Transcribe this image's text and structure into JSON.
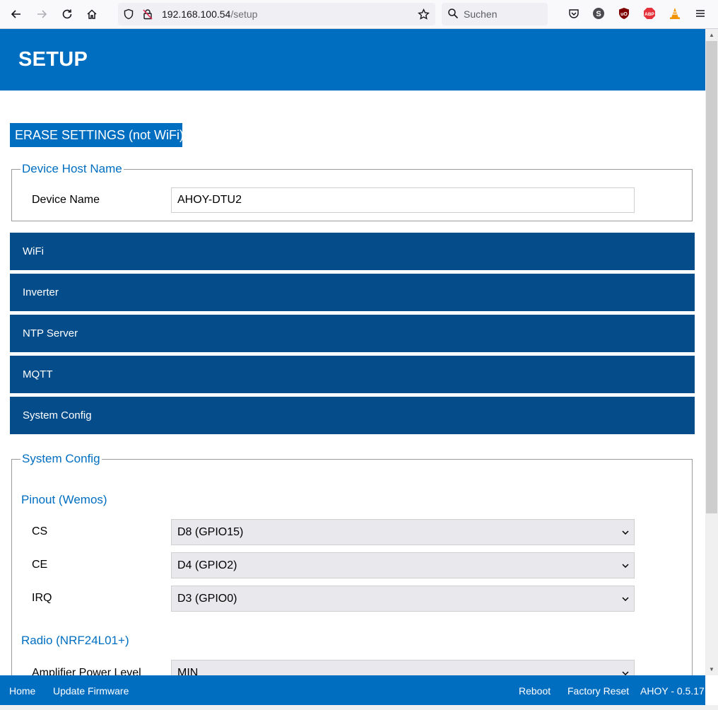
{
  "browser": {
    "url_host": "192.168.100.54",
    "url_path": "/setup",
    "search_placeholder": "Suchen"
  },
  "page": {
    "title": "SETUP",
    "erase_button": "ERASE SETTINGS (not WiFi)"
  },
  "device_host": {
    "legend": "Device Host Name",
    "device_name_label": "Device Name",
    "device_name_value": "AHOY-DTU2"
  },
  "sections": [
    {
      "label": "WiFi"
    },
    {
      "label": "Inverter"
    },
    {
      "label": "NTP Server"
    },
    {
      "label": "MQTT"
    },
    {
      "label": "System Config"
    }
  ],
  "system_config": {
    "legend": "System Config",
    "pinout_heading": "Pinout (Wemos)",
    "pins": [
      {
        "label": "CS",
        "value": "D8 (GPIO15)"
      },
      {
        "label": "CE",
        "value": "D4 (GPIO2)"
      },
      {
        "label": "IRQ",
        "value": "D3 (GPIO0)"
      }
    ],
    "radio_heading": "Radio (NRF24L01+)",
    "amp_label": "Amplifier Power Level",
    "amp_value": "MIN"
  },
  "footer": {
    "home": "Home",
    "update_firmware": "Update Firmware",
    "reboot": "Reboot",
    "factory_reset": "Factory Reset",
    "version": "AHOY - 0.5.17"
  },
  "colors": {
    "header_blue": "#006ec0",
    "section_bar": "#044d8a",
    "legend_text": "#006ec0"
  }
}
